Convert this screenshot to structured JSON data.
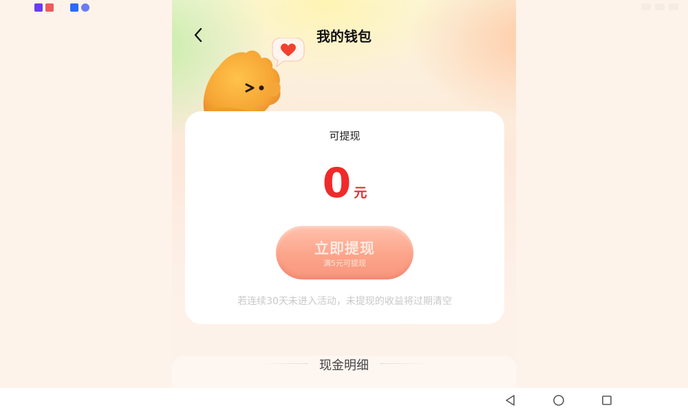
{
  "status_bar": {
    "left_icons": [
      "app-badge-icon",
      "news-app-icon",
      "cloud-app-icon",
      "music-app-icon"
    ],
    "icon_colors": [
      "#6a3cf0",
      "#f05a5a",
      "#2b6cf5",
      "#6b7cf0"
    ]
  },
  "header": {
    "title": "我的钱包",
    "back_icon": "chevron-left-icon"
  },
  "wallet_card": {
    "label": "可提现",
    "amount": "0",
    "unit": "元",
    "withdraw_button_label": "立即提现",
    "withdraw_button_sub": "满5元可提现",
    "expire_note": "若连续30天未进入活动，未提现的收益将过期清空"
  },
  "details": {
    "title": "现金明细"
  },
  "nav_bar": {
    "icons": [
      "back-triangle-icon",
      "home-circle-icon",
      "recents-square-icon"
    ]
  },
  "colors": {
    "amount": "#f02a2a",
    "button": "#fca48a",
    "note": "#c8c8c8"
  }
}
